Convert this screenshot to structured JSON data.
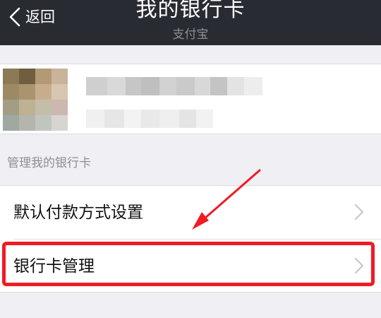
{
  "nav": {
    "back_label": "返回",
    "title": "我的银行卡",
    "subtitle": "支付宝"
  },
  "account": {
    "avatar_icon": "pixelated-avatar-icon"
  },
  "section": {
    "header": "管理我的银行卡"
  },
  "list": {
    "items": [
      {
        "label": "默认付款方式设置",
        "icon": "chevron-right-icon"
      },
      {
        "label": "银行卡管理",
        "icon": "chevron-right-icon",
        "highlighted": true
      }
    ]
  },
  "annotation": {
    "color": "#ef1c24",
    "arrow_icon": "red-arrow-icon"
  },
  "colors": {
    "navbar": "#292b33",
    "background": "#efeff4",
    "highlight": "#ef1c24"
  }
}
